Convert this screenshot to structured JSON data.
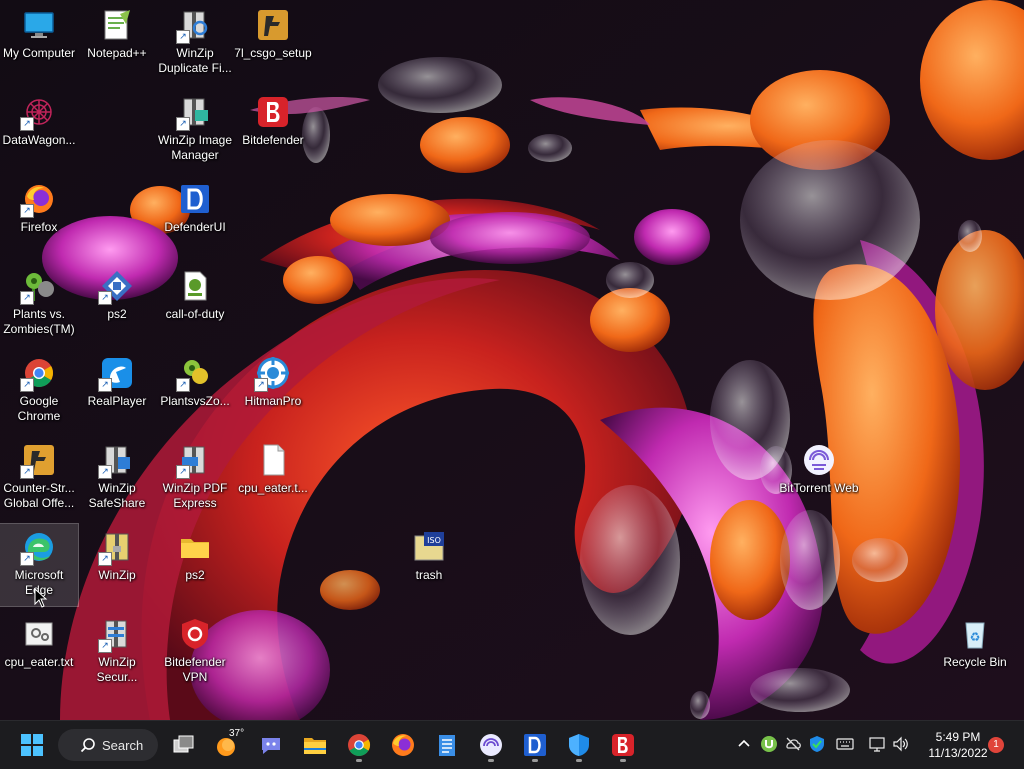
{
  "desktop": {
    "icons": [
      {
        "label": "My Computer"
      },
      {
        "label": "Notepad++"
      },
      {
        "label": "WinZip Duplicate Fi..."
      },
      {
        "label": "7l_csgo_setup"
      },
      {
        "label": "DataWagon..."
      },
      {
        "label": "WinZip Image Manager"
      },
      {
        "label": "Bitdefender"
      },
      {
        "label": "Firefox"
      },
      {
        "label": "DefenderUI"
      },
      {
        "label": "Plants vs. Zombies(TM)"
      },
      {
        "label": "ps2"
      },
      {
        "label": "call-of-duty"
      },
      {
        "label": "Google Chrome"
      },
      {
        "label": "RealPlayer"
      },
      {
        "label": "PlantsvsZo..."
      },
      {
        "label": "HitmanPro"
      },
      {
        "label": "Counter-Str... Global Offe..."
      },
      {
        "label": "WinZip SafeShare"
      },
      {
        "label": "WinZip PDF Express"
      },
      {
        "label": "cpu_eater.t..."
      },
      {
        "label": "BitTorrent Web"
      },
      {
        "label": "Microsoft Edge"
      },
      {
        "label": "WinZip"
      },
      {
        "label": "ps2"
      },
      {
        "label": "trash"
      },
      {
        "label": "cpu_eater.txt"
      },
      {
        "label": "WinZip Secur..."
      },
      {
        "label": "Bitdefender VPN"
      },
      {
        "label": "Recycle Bin"
      }
    ]
  },
  "taskbar": {
    "search_label": "Search",
    "weather_temp": "37°",
    "pinned": [
      {
        "icon": "start-icon"
      },
      {
        "icon": "task-view-icon"
      },
      {
        "icon": "weather-icon"
      },
      {
        "icon": "teams-chat-icon"
      },
      {
        "icon": "file-explorer-icon"
      },
      {
        "icon": "chrome-icon"
      },
      {
        "icon": "firefox-icon"
      },
      {
        "icon": "notepad-icon"
      },
      {
        "icon": "bittorrent-icon"
      },
      {
        "icon": "defenderui-icon"
      },
      {
        "icon": "windows-security-icon"
      },
      {
        "icon": "bitdefender-icon"
      }
    ],
    "clock": {
      "time": "5:49 PM",
      "date": "11/13/2022"
    },
    "notifications": "1"
  },
  "colors": {
    "taskbar": "#1c1c1f",
    "accent": "#0078d4",
    "bitdefender": "#d8232a"
  }
}
